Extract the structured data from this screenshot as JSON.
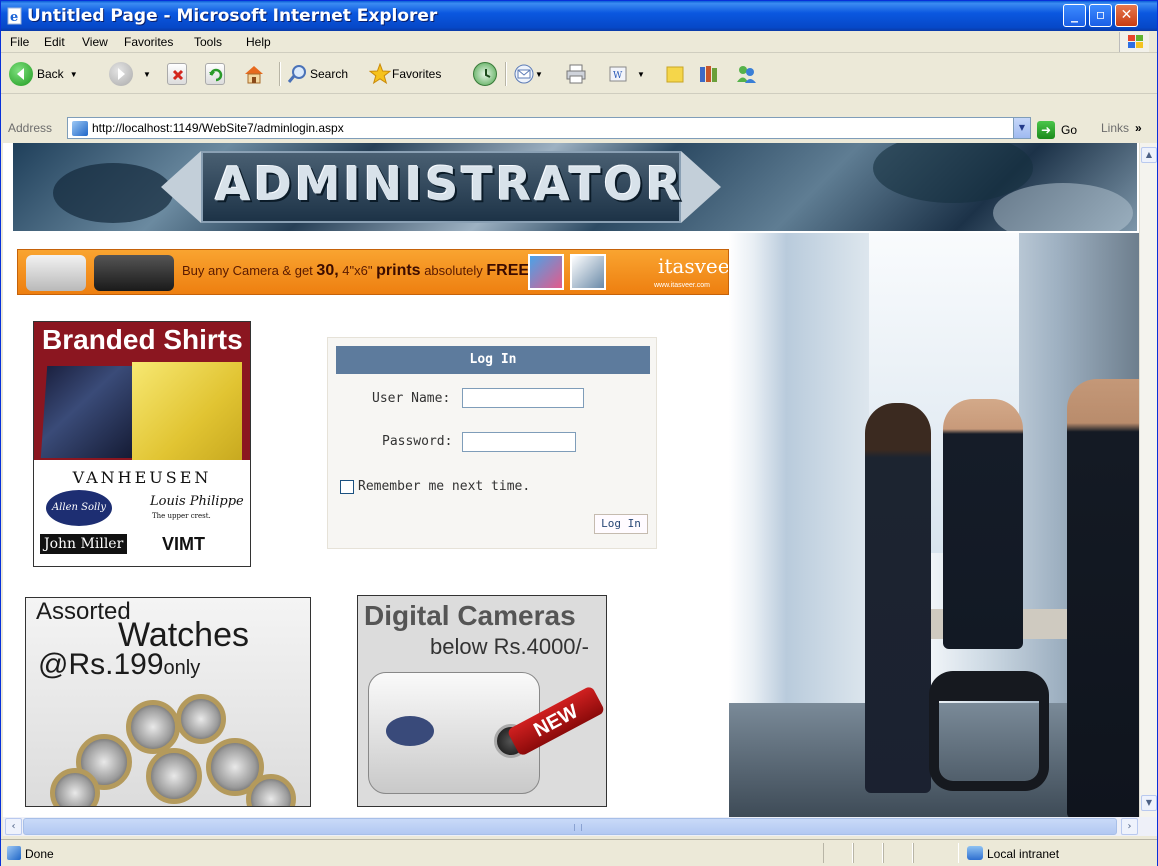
{
  "window": {
    "title": "Untitled Page - Microsoft Internet Explorer",
    "controls": [
      "_",
      "▫",
      "✕"
    ]
  },
  "menu": [
    "File",
    "Edit",
    "View",
    "Favorites",
    "Tools",
    "Help"
  ],
  "toolbar": {
    "back_label": "Back",
    "search_label": "Search",
    "favorites_label": "Favorites"
  },
  "address": {
    "label": "Address",
    "url": "http://localhost:1149/WebSite7/adminlogin.aspx",
    "go_label": "Go",
    "links_label": "Links"
  },
  "page": {
    "banner_text": "ADMINISTRATOR",
    "promo": {
      "text_prefix": "Buy any Camera & get",
      "count": "30,",
      "size": "4\"x6\"",
      "prints": "prints",
      "suffix": "absolutely",
      "free": "FREE",
      "brand": "itasveer",
      "brand_url": "www.itasveer.com"
    },
    "shirts_ad": {
      "title": "Branded Shirts",
      "brand1": "VANHEUSEN",
      "brand2": "Allen Solly",
      "brand3": "Louis Philippe",
      "brand3_tag": "The upper crest.",
      "brand4": "John Miller",
      "brand5": "VIMT"
    },
    "login": {
      "title": "Log In",
      "username_label": "User Name:",
      "password_label": "Password:",
      "remember_label": "Remember me next time.",
      "button_label": "Log In"
    },
    "watch_ad": {
      "line1": "Assorted",
      "line2": "Watches",
      "price": "@Rs.199",
      "only": "only"
    },
    "camera_ad": {
      "line1": "Digital Cameras",
      "line2": "below Rs.4000/-",
      "badge": "NEW"
    }
  },
  "status": {
    "text": "Done",
    "zone": "Local intranet"
  }
}
